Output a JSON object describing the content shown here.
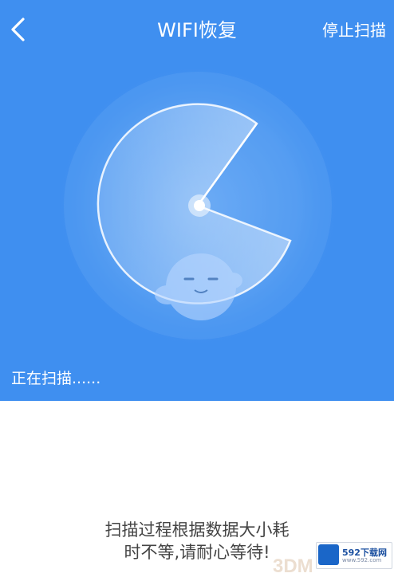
{
  "navbar": {
    "title": "WIFI恢复",
    "stop_label": "停止扫描"
  },
  "status": {
    "text": "正在扫描......"
  },
  "tip": {
    "line1": "扫描过程根据数据大小耗",
    "line2": "时不等,请耐心等待!"
  },
  "watermark": {
    "brand": "592下载网",
    "site": "www.592.com",
    "logo_text": "3DM"
  },
  "colors": {
    "primary": "#3f8ff0",
    "background": "#ffffff",
    "text": "#444444"
  },
  "icons": {
    "back": "chevron-left-icon",
    "mascot": "bird-mascot-icon"
  }
}
